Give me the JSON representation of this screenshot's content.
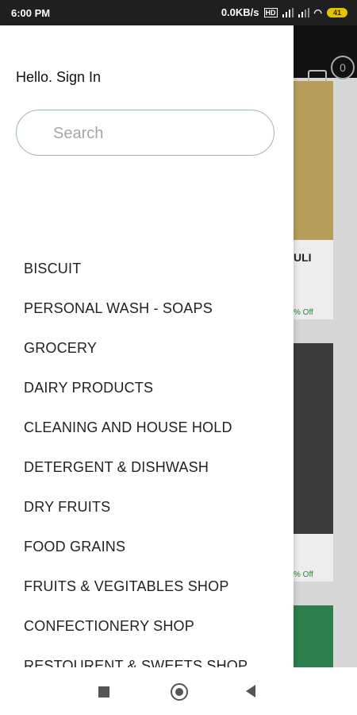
{
  "status_bar": {
    "time": "6:00 PM",
    "net_speed": "0.0KB/s",
    "volte": "HD",
    "battery": "41"
  },
  "background": {
    "cart_count": "0",
    "product_name": "ULI",
    "discount_1": "% Off",
    "discount_2": "% Off"
  },
  "drawer": {
    "greeting": "Hello. Sign In",
    "search_placeholder": "Search",
    "categories": [
      "BISCUIT",
      "PERSONAL WASH - SOAPS",
      "GROCERY",
      "DAIRY PRODUCTS",
      "CLEANING AND HOUSE HOLD",
      "DETERGENT & DISHWASH",
      "DRY FRUITS",
      "FOOD GRAINS",
      "FRUITS & VEGITABLES SHOP",
      "CONFECTIONERY SHOP",
      "RESTOURENT & SWEETS SHOP"
    ]
  },
  "nav_bar": {
    "recents_icon": "square-icon",
    "home_icon": "circle-icon",
    "back_icon": "triangle-back-icon"
  }
}
